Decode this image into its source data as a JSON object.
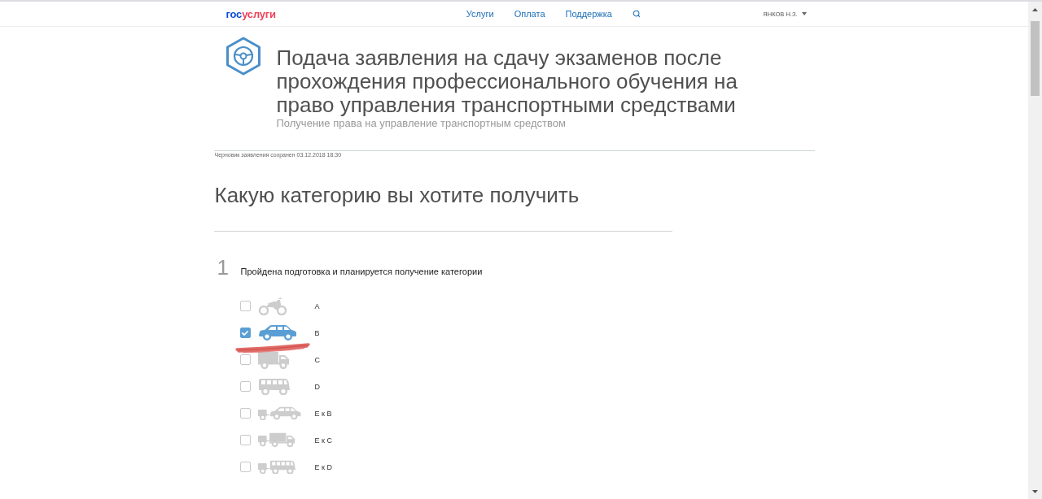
{
  "header": {
    "logo": {
      "part_1": "гос",
      "part_2": "услуги"
    },
    "nav": [
      {
        "label": "Услуги"
      },
      {
        "label": "Оплата"
      },
      {
        "label": "Поддержка"
      }
    ],
    "user": "ЯНКОВ Н.З."
  },
  "service": {
    "title": "Подача заявления на сдачу экзаменов после прохождения профессионального обучения на право управления транспортными средствами",
    "subtitle": "Получение права на управление транспортным средством"
  },
  "draft_status": "Черновик заявления сохранен 03.12.2018 18:30",
  "section": {
    "heading": "Какую категорию вы хотите получить"
  },
  "question": {
    "number": "1",
    "text": "Пройдена подготовка и планируется получение категории",
    "options": [
      {
        "label": "A",
        "kind": "motorcycle",
        "checked": false
      },
      {
        "label": "B",
        "kind": "car",
        "checked": true
      },
      {
        "label": "C",
        "kind": "truck",
        "checked": false
      },
      {
        "label": "D",
        "kind": "bus",
        "checked": false
      },
      {
        "label": "E к B",
        "kind": "car-trailer",
        "checked": false
      },
      {
        "label": "E к C",
        "kind": "truck-trailer",
        "checked": false
      },
      {
        "label": "E к D",
        "kind": "bus-trailer",
        "checked": false
      }
    ]
  }
}
